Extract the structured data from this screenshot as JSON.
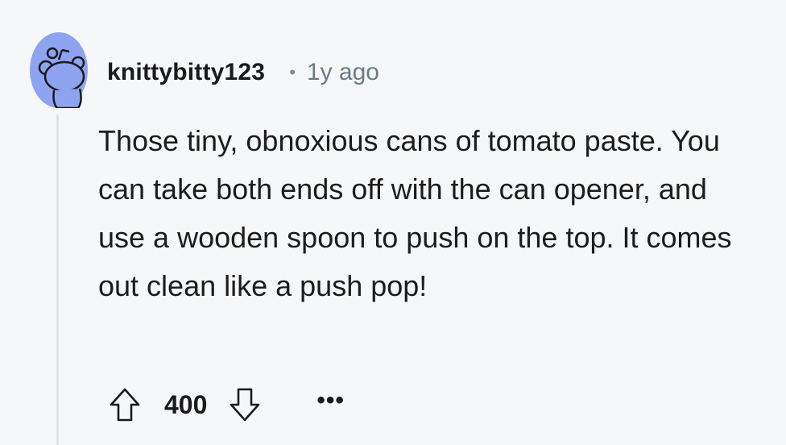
{
  "comment": {
    "author": "knittybitty123",
    "separator": "•",
    "timestamp": "1y ago",
    "body": "Those tiny, obnoxious cans of tomato paste. You can take both ends off with the can opener, and use a wooden spoon to push on the top. It comes out clean like a push pop!",
    "score": "400",
    "more_label": "•••"
  },
  "icons": {
    "avatar": "reddit-snoo-avatar-icon",
    "upvote": "upvote-arrow-icon",
    "downvote": "downvote-arrow-icon",
    "more": "more-options-icon"
  },
  "colors": {
    "background": "#f6f7f8",
    "avatar_bg": "#8fa4f0",
    "meta_text": "#6b7b85",
    "thread_line": "#dfe2e4"
  }
}
